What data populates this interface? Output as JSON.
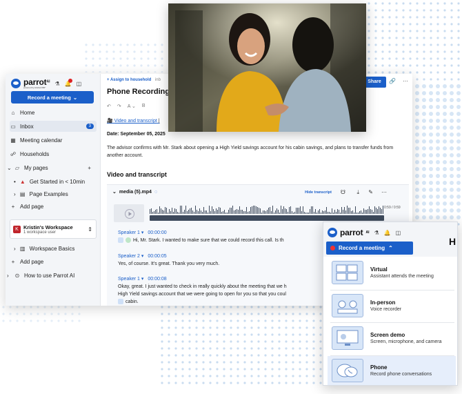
{
  "brand": {
    "name": "parrot",
    "superscript": "AI",
    "tagline": "powered by Advisor360°",
    "accent": "#1b5fc9"
  },
  "sidebar": {
    "record_button": "Record a meeting",
    "nav": [
      {
        "icon": "home-icon",
        "label": "Home"
      },
      {
        "icon": "inbox-icon",
        "label": "Inbox",
        "badge": "3"
      },
      {
        "icon": "calendar-icon",
        "label": "Meeting calendar"
      },
      {
        "icon": "households-icon",
        "label": "Households"
      },
      {
        "icon": "folder-icon",
        "label": "My pages"
      },
      {
        "icon": "page-icon",
        "label": "Get Started in < 10min"
      },
      {
        "icon": "page-icon",
        "label": "Page Examples"
      },
      {
        "icon": "plus-icon",
        "label": "Add page"
      }
    ],
    "workspace": {
      "avatar": "K",
      "name": "Kristin's Workspace",
      "sub": "1 workspace user"
    },
    "workspace_items": [
      {
        "label": "Workspace Basics"
      },
      {
        "label": "Add page"
      },
      {
        "label": "How to use Parrot AI"
      }
    ]
  },
  "main": {
    "breadcrumb": "+ Assign to household",
    "breadcrumb_tail": "inb",
    "title": "Phone Recording",
    "share_button": "Share",
    "video_link": "Video and transcript",
    "video_link_tail": "|",
    "date_label": "Date: September 05, 2025",
    "summary": "The advisor confirms with Mr. Stark about opening a High Yield savings account for his cabin savings, and plans to transfer funds from another account.",
    "section_title": "Video and transcript",
    "media": {
      "filename": "media (5).mp4",
      "hide_transcript": "Hide transcript",
      "duration": "0:59 / 0:59"
    },
    "transcript": [
      {
        "speaker": "Speaker 1",
        "time": "00:00:00",
        "text": "Hi, Mr. Stark. I wanted to make sure that we could record this call. Is th"
      },
      {
        "speaker": "Speaker 2",
        "time": "00:00:05",
        "text": "Yes, of course. It's great. Thank you very much."
      },
      {
        "speaker": "Speaker 1",
        "time": "00:00:08",
        "text": "Okay, great. I just wanted to check in really quickly about the meeting that we h",
        "text2": "High Yield savings account that we were going to open for you so that you coul",
        "text3": "cabin."
      }
    ]
  },
  "dropdown": {
    "record_button": "Record a meeting",
    "options": [
      {
        "title": "Virtual",
        "subtitle": "Assistant attends the meeting"
      },
      {
        "title": "In-person",
        "subtitle": "Voice recorder"
      },
      {
        "title": "Screen demo",
        "subtitle": "Screen, microphone, and camera"
      },
      {
        "title": "Phone",
        "subtitle": "Record phone conversations"
      }
    ]
  }
}
